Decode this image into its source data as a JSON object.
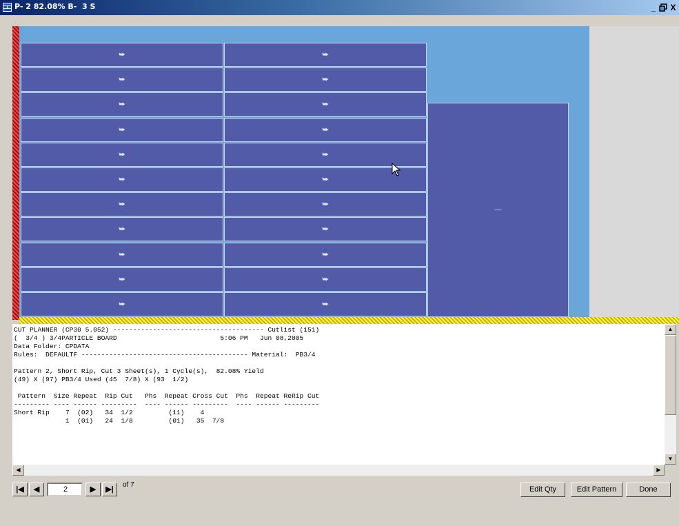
{
  "window": {
    "title": "P- 2 82.08% B-  3 S",
    "minimize_label": "_",
    "restore_label": "И",
    "close_label": "X"
  },
  "layout": {
    "piece_marker_small": "⮩",
    "piece_marker_large": "—"
  },
  "report": {
    "lines": [
      "CUT PLANNER (CP30 5.052) -------------------------------------- Cutlist (151)",
      "(  3/4 ) 3/4PARTICLE BOARD                          5:06 PM   Jun 08,2005",
      "Data Folder: CPDATA",
      "Rules:  DEFAULTF ------------------------------------------ Material:  PB3/4",
      "",
      "Pattern 2, Short Rip, Cut 3 Sheet(s), 1 Cycle(s),  82.08% Yield",
      "(49) X (97) PB3/4 Used (45  7/8) X (93  1/2)",
      "",
      " Pattern  Size Repeat  Rip Cut   Phs  Repeat Cross Cut  Phs  Repeat ReRip Cut",
      "--------- ---- ------ ---------  ---- ------ ---------  ---- ------ ---------",
      "Short Rip    7  (02)   34  1/2         (11)    4",
      "             1  (01)   24  1/8         (01)   35  7/8"
    ]
  },
  "nav": {
    "first_label": "|◀",
    "prev_label": "◀",
    "page_value": "2",
    "next_label": "▶",
    "last_label": "▶|",
    "of_label": "of 7"
  },
  "buttons": {
    "edit_qty": "Edit Qty",
    "edit_pattern": "Edit Pattern",
    "done": "Done"
  }
}
